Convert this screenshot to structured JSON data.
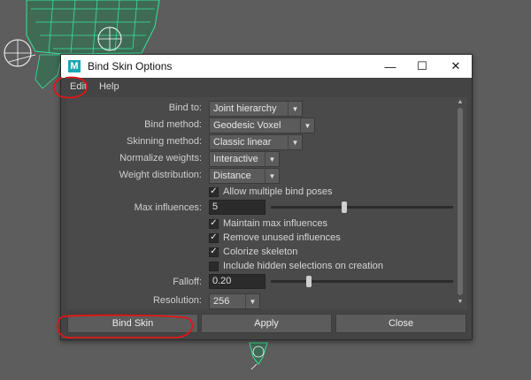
{
  "dialog": {
    "title": "Bind Skin Options",
    "app_icon": "M",
    "controls": {
      "minimize": "—",
      "maximize": "☐",
      "close": "✕"
    }
  },
  "menu": {
    "edit": "Edit",
    "help": "Help"
  },
  "options": {
    "bind_to": {
      "label": "Bind to:",
      "value": "Joint hierarchy"
    },
    "bind_method": {
      "label": "Bind method:",
      "value": "Geodesic Voxel"
    },
    "skinning_method": {
      "label": "Skinning method:",
      "value": "Classic linear"
    },
    "normalize_weights": {
      "label": "Normalize weights:",
      "value": "Interactive"
    },
    "weight_distribution": {
      "label": "Weight distribution:",
      "value": "Distance"
    },
    "allow_multiple_bind_poses": {
      "label": "Allow multiple bind poses",
      "checked": true
    },
    "max_influences": {
      "label": "Max influences:",
      "value": "5",
      "slider_fraction": 0.4
    },
    "maintain_max_influences": {
      "label": "Maintain max influences",
      "checked": true
    },
    "remove_unused_influences": {
      "label": "Remove unused influences",
      "checked": true
    },
    "colorize_skeleton": {
      "label": "Colorize skeleton",
      "checked": true
    },
    "include_hidden_selections": {
      "label": "Include hidden selections on creation",
      "checked": false
    },
    "falloff": {
      "label": "Falloff:",
      "value": "0.20",
      "slider_fraction": 0.2
    },
    "resolution": {
      "label": "Resolution:",
      "value": "256"
    }
  },
  "buttons": {
    "bind_skin": "Bind Skin",
    "apply": "Apply",
    "close": "Close"
  },
  "glyphs": {
    "check": "✓",
    "dropdown_arrow": "▼",
    "scroll_up": "▲",
    "scroll_down": "▼"
  },
  "colors": {
    "viewport_bg": "#5d5d5d",
    "wireframe": "#37e39a",
    "annotation_red": "#e01616",
    "app_icon_bg": "#1aa7b4"
  }
}
